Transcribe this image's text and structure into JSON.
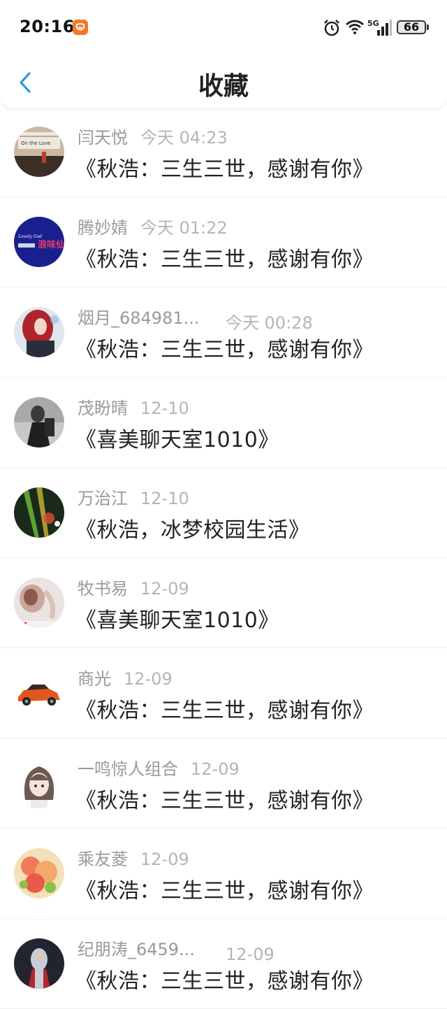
{
  "status_bar": {
    "time": "20:16",
    "battery": "66",
    "signal_label": "5G"
  },
  "header": {
    "title": "收藏"
  },
  "favorites": [
    {
      "user": "闫天悦",
      "time": "今天 04:23",
      "title": "《秋浩：三生三世，感谢有你》"
    },
    {
      "user": "腾妙婧",
      "time": "今天 01:22",
      "title": "《秋浩：三生三世，感谢有你》"
    },
    {
      "user": "烟月_684981...",
      "time": "今天 00:28",
      "title": "《秋浩：三生三世，感谢有你》"
    },
    {
      "user": "茂盼晴",
      "time": "12-10",
      "title": "《喜美聊天室1010》"
    },
    {
      "user": "万治江",
      "time": "12-10",
      "title": "《秋浩，冰梦校园生活》"
    },
    {
      "user": "牧书易",
      "time": "12-09",
      "title": "《喜美聊天室1010》"
    },
    {
      "user": "商光",
      "time": "12-09",
      "title": "《秋浩：三生三世，感谢有你》"
    },
    {
      "user": "一鸣惊人组合",
      "time": "12-09",
      "title": "《秋浩：三生三世，感谢有你》"
    },
    {
      "user": "乘友菱",
      "time": "12-09",
      "title": "《秋浩：三生三世，感谢有你》"
    },
    {
      "user": "纪朋涛_6459...",
      "time": "12-09",
      "title": "《秋浩：三生三世，感谢有你》"
    }
  ],
  "avatar_texts": {
    "item1": "On the Love",
    "item2_small": "Lovely God",
    "item2_big": "浪味仙"
  },
  "colors": {
    "accent": "#2f9ae8",
    "name_gray": "#9a9a9a",
    "title_dark": "#222222"
  }
}
